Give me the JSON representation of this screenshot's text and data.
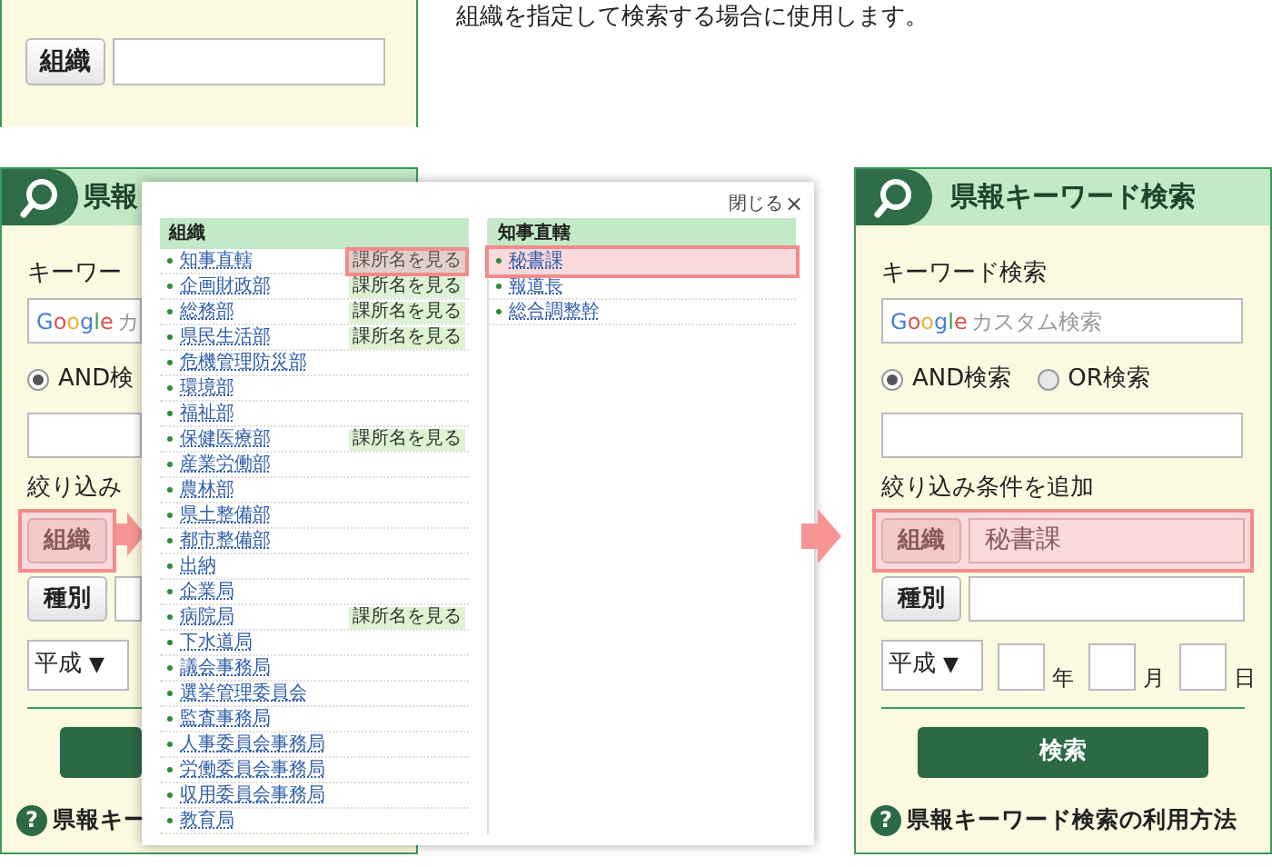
{
  "snippet": {
    "button": "組織",
    "description": "組織を指定して検索する場合に使用します。"
  },
  "before_panel": {
    "title": "県報",
    "keyword_label": "キーワー",
    "search_brand": "Google",
    "search_placeholder": "カ",
    "radios": [
      {
        "label": "AND検",
        "selected": true
      }
    ],
    "filter_label": "絞り込み",
    "filters": [
      {
        "button": "組織",
        "highlighted": true
      },
      {
        "button": "種別",
        "highlighted": false
      }
    ],
    "era": "平成",
    "era_caret": "▼",
    "help_icon": "?",
    "help_link": "県報キー"
  },
  "popup": {
    "close_label": "閉じる",
    "close_icon": "×",
    "columns": [
      {
        "header": "組織",
        "items": [
          {
            "label": "知事直轄",
            "badge": "課所名を見る",
            "selected": true
          },
          {
            "label": "企画財政部",
            "badge": "課所名を見る",
            "selected": false
          },
          {
            "label": "総務部",
            "badge": "課所名を見る",
            "selected": false
          },
          {
            "label": "県民生活部",
            "badge": "課所名を見る",
            "selected": false
          },
          {
            "label": "危機管理防災部",
            "selected": false
          },
          {
            "label": "環境部",
            "selected": false
          },
          {
            "label": "福祉部",
            "selected": false
          },
          {
            "label": "保健医療部",
            "badge": "課所名を見る",
            "selected": false
          },
          {
            "label": "産業労働部",
            "selected": false
          },
          {
            "label": "農林部",
            "selected": false
          },
          {
            "label": "県土整備部",
            "selected": false
          },
          {
            "label": "都市整備部",
            "selected": false
          },
          {
            "label": "出納",
            "selected": false
          },
          {
            "label": "企業局",
            "selected": false
          },
          {
            "label": "病院局",
            "badge": "課所名を見る",
            "selected": false
          },
          {
            "label": "下水道局",
            "selected": false
          },
          {
            "label": "議会事務局",
            "selected": false
          },
          {
            "label": "選挙管理委員会",
            "selected": false
          },
          {
            "label": "監査事務局",
            "selected": false
          },
          {
            "label": "人事委員会事務局",
            "selected": false
          },
          {
            "label": "労働委員会事務局",
            "selected": false
          },
          {
            "label": "収用委員会事務局",
            "selected": false
          },
          {
            "label": "教育局",
            "selected": false
          }
        ]
      },
      {
        "header": "知事直轄",
        "items": [
          {
            "label": "秘書課",
            "selected": true
          },
          {
            "label": "報道長",
            "selected": false
          },
          {
            "label": "総合調整幹",
            "selected": false
          }
        ]
      }
    ]
  },
  "after_panel": {
    "title": "県報キーワード検索",
    "keyword_label": "キーワード検索",
    "search_brand": "Google",
    "search_placeholder": "カスタム検索",
    "radios": [
      {
        "label": "AND検索",
        "selected": true
      },
      {
        "label": "OR検索",
        "selected": false
      }
    ],
    "filter_label": "絞り込み条件を追加",
    "filters": [
      {
        "button": "組織",
        "value": "秘書課",
        "highlighted": true
      },
      {
        "button": "種別",
        "highlighted": false
      }
    ],
    "era": "平成",
    "era_caret": "▼",
    "date_units": [
      "年",
      "月",
      "日"
    ],
    "search_button": "検索",
    "help_icon": "?",
    "help_link": "県報キーワード検索の利用方法"
  }
}
